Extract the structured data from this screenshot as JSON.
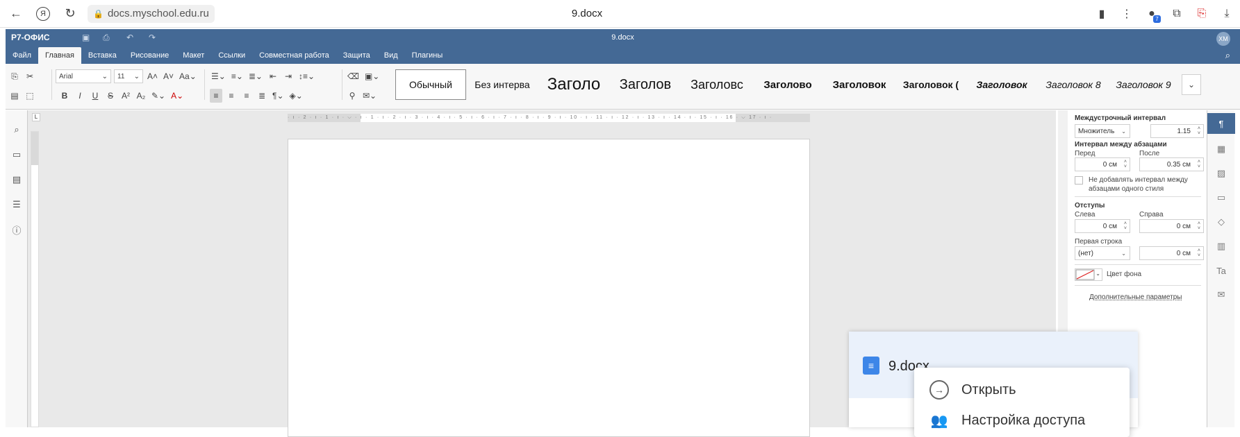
{
  "browser": {
    "url": "docs.myschool.edu.ru",
    "tab_title": "9.docx",
    "download_badge": "7"
  },
  "app": {
    "logo": "Р7-ОФИС",
    "doc_title": "9.docx",
    "avatar": "ХМ",
    "menu": [
      "Файл",
      "Главная",
      "Вставка",
      "Рисование",
      "Макет",
      "Ссылки",
      "Совместная работа",
      "Защита",
      "Вид",
      "Плагины"
    ],
    "active_menu": "Главная"
  },
  "toolbar": {
    "font_name": "Arial",
    "font_size": "11",
    "styles": [
      "Обычный",
      "Без интерва",
      "Заголо",
      "Заголов",
      "Заголовс",
      "Заголово",
      "Заголовок",
      "Заголовок (",
      "Заголовок",
      "Заголовок 8",
      "Заголовок 9"
    ]
  },
  "ruler": {
    "ticks": "· ı · 2 · ı · 1 · ı · ⌵ · ı · 1 · ı · 2 · ı · 3 · ı · 4 · ı · 5 · ı · 6 · ı · 7 · ı · 8 · ı · 9 · ı · 10 · ı · 11 · ı · 12 · ı · 13 · ı · 14 · ı · 15 · ı · 16 · ⌵ 17 · ı ·"
  },
  "paragraph_panel": {
    "line_spacing_title": "Междустрочный интервал",
    "line_spacing_mode": "Множитель",
    "line_spacing_value": "1.15",
    "para_spacing_title": "Интервал между абзацами",
    "before_label": "Перед",
    "after_label": "После",
    "before_value": "0 см",
    "after_value": "0.35 см",
    "no_space_label": "Не добавлять интервал между абзацами одного стиля",
    "indents_title": "Отступы",
    "left_label": "Слева",
    "right_label": "Справа",
    "left_value": "0 см",
    "right_value": "0 см",
    "first_line_label": "Первая строка",
    "first_line_mode": "(нет)",
    "first_line_value": "0 см",
    "bg_color_label": "Цвет фона",
    "advanced_link": "Дополнительные параметры"
  },
  "popup": {
    "file_name": "9.docx",
    "context_items": [
      "Открыть",
      "Настройка доступа"
    ]
  },
  "colors": {
    "header_blue": "#446995",
    "file_icon_blue": "#3d86e8"
  }
}
